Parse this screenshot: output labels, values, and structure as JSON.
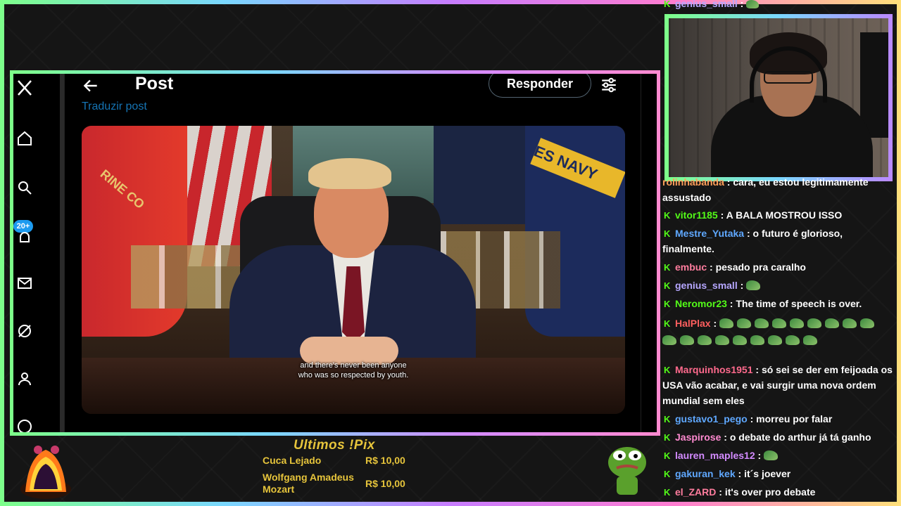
{
  "post_header": {
    "title": "Post",
    "reply_label": "Responder",
    "translate_label": "Traduzir post"
  },
  "sidebar": {
    "badge": "20+"
  },
  "video": {
    "subtitle_line1": "and there's never been anyone",
    "subtitle_line2": "who was so respected by youth.",
    "flag_text": "ES NAVY",
    "marine_text": "RINE CO"
  },
  "chat": {
    "cut_top": {
      "user": "genius_small",
      "user_color": "#b6a7ff"
    },
    "partial_user": "rolinhabanda",
    "partial_text": "cara, eu estou legitimamente assustado",
    "messages": [
      {
        "user": "vitor1185",
        "color": "#53fc18",
        "text": "A BALA MOSTROU ISSO"
      },
      {
        "user": "Mestre_Yutaka",
        "color": "#5fa8ff",
        "text": "o futuro é glorioso, finalmente."
      },
      {
        "user": "embuc",
        "color": "#ff7d9e",
        "text": "pesado pra caralho"
      },
      {
        "user": "genius_small",
        "color": "#b6a7ff",
        "text": ""
      },
      {
        "user": "Neromor23",
        "color": "#53fc18",
        "text": "The time of speech is over."
      },
      {
        "user": "HalPlax",
        "color": "#ff5f5f",
        "text": ""
      },
      {
        "user": "Marquinhos1951",
        "color": "#ff6a8d",
        "text": "só sei se der em feijoada os USA vão acabar, e vai surgir uma nova ordem mundial sem eles"
      },
      {
        "user": "gustavo1_pego",
        "color": "#5fa8ff",
        "text": "morreu por falar"
      },
      {
        "user": "Jaspirose",
        "color": "#ff8ad0",
        "text": "o debate do arthur já tá ganho"
      },
      {
        "user": "lauren_maples12",
        "color": "#d38bff",
        "text": ""
      },
      {
        "user": "gakuran_kek",
        "color": "#5fa8ff",
        "text": "it´s joever"
      },
      {
        "user": "el_ZARD",
        "color": "#ff7d9e",
        "text": "it's over pro debate"
      }
    ]
  },
  "pix": {
    "title": "Ultimos !Pix",
    "rows": [
      {
        "name": "Cuca Lejado",
        "amount": "R$ 10,00"
      },
      {
        "name": "Wolfgang Amadeus Mozart",
        "amount": "R$ 10,00"
      }
    ]
  },
  "colors": {
    "accent_blue": "#1d9bf0",
    "kick_green": "#53fc18",
    "pix_gold": "#e6c43b"
  }
}
